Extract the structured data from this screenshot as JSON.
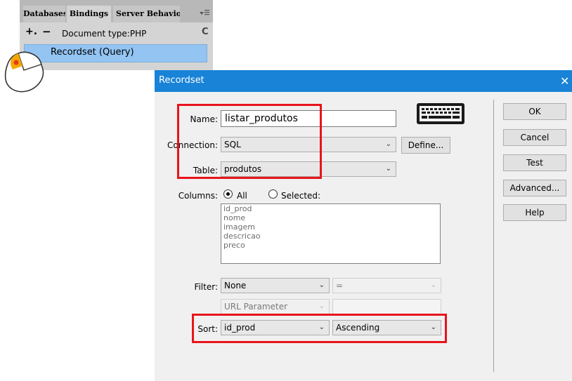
{
  "panel": {
    "tabs": [
      "Databases",
      "Bindings",
      "Server Behaviors"
    ],
    "add_glyph": "+.",
    "remove_glyph": "−",
    "doc_type": "Document type:PHP",
    "refresh_glyph": "C",
    "selected_item": "Recordset (Query)"
  },
  "dialog": {
    "title": "Recordset",
    "close_glyph": "✕",
    "name": {
      "label": "Name:",
      "value": "listar_produtos"
    },
    "connection": {
      "label": "Connection:",
      "value": "SQL",
      "define_label": "Define..."
    },
    "table": {
      "label": "Table:",
      "value": "produtos"
    },
    "columns": {
      "label": "Columns:",
      "all_label": "All",
      "selected_label": "Selected:",
      "selected_option": "All",
      "items": [
        "id_prod",
        "nome",
        "imagem",
        "descricao",
        "preco"
      ]
    },
    "filter": {
      "label": "Filter:",
      "column": "None",
      "operator": "=",
      "param_type": "URL Parameter",
      "param_value": ""
    },
    "sort": {
      "label": "Sort:",
      "column": "id_prod",
      "order": "Ascending"
    },
    "buttons": {
      "ok": "OK",
      "cancel": "Cancel",
      "test": "Test",
      "advanced": "Advanced...",
      "help": "Help"
    }
  },
  "colors": {
    "titlebar": "#1883d7",
    "highlight": "#e8141b",
    "selection": "#93c4f2"
  },
  "icons": [
    "mouse-click-icon",
    "keyboard-icon",
    "menu-options-icon",
    "refresh-icon",
    "close-icon"
  ]
}
